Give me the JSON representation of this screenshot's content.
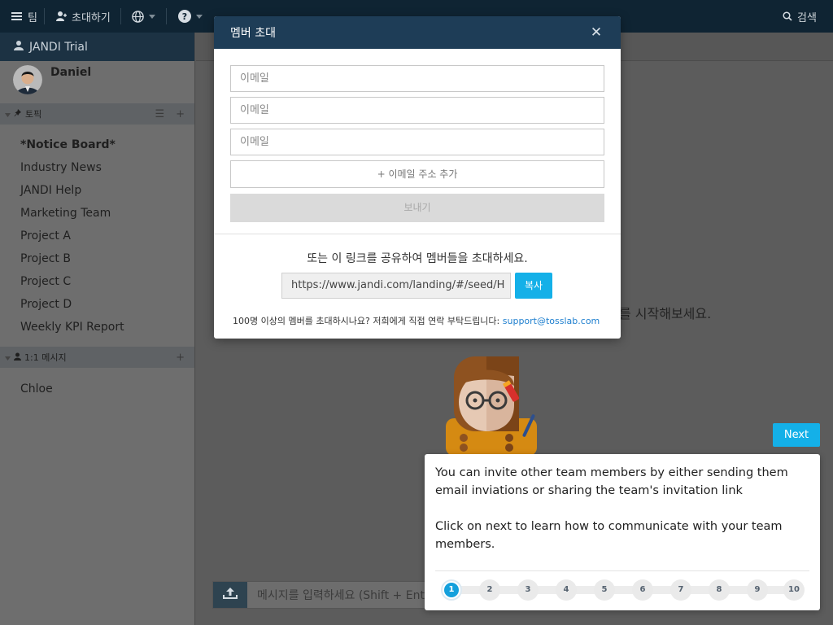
{
  "topbar": {
    "team_label": "팀",
    "invite_label": "초대하기",
    "search_label": "검색"
  },
  "sidebar": {
    "team_name": "JANDI Trial",
    "user_name": "Daniel",
    "topics_header": "토픽",
    "topics": [
      "*Notice Board*",
      "Industry News",
      "JANDI Help",
      "Marketing Team",
      "Project A",
      "Project B",
      "Project C",
      "Project D",
      "Weekly KPI Report"
    ],
    "dm_header": "1:1 메시지",
    "dms": [
      "Chloe"
    ]
  },
  "main": {
    "welcome_text": "를 시작해보세요.",
    "message_placeholder": "메시지를 입력하세요 (Shift + Ente"
  },
  "modal": {
    "title": "멤버 초대",
    "email_placeholder": "이메일",
    "add_email_label": "+ 이메일 주소 추가",
    "send_label": "보내기",
    "share_text": "또는 이 링크를 공유하여 멤버들을 초대하세요.",
    "invite_link": "https://www.jandi.com/landing/#/seed/H‍",
    "copy_label": "복사",
    "contact_text": "100명 이상의 멤버를 초대하시나요? 저희에게 직접 연락 부탁드립니다:",
    "contact_email": "support@tosslab.com"
  },
  "tour": {
    "next_label": "Next",
    "paragraph1": "You can invite other team members by either sending them email inviations or sharing the team's invitation link",
    "paragraph2": "Click on next to learn how to communicate with your team members.",
    "steps": [
      "1",
      "2",
      "3",
      "4",
      "5",
      "6",
      "7",
      "8",
      "9",
      "10"
    ],
    "current_step": 1
  },
  "colors": {
    "accent": "#14b0e8",
    "modal_header": "#1e3d57",
    "topbar": "#0f2433"
  }
}
